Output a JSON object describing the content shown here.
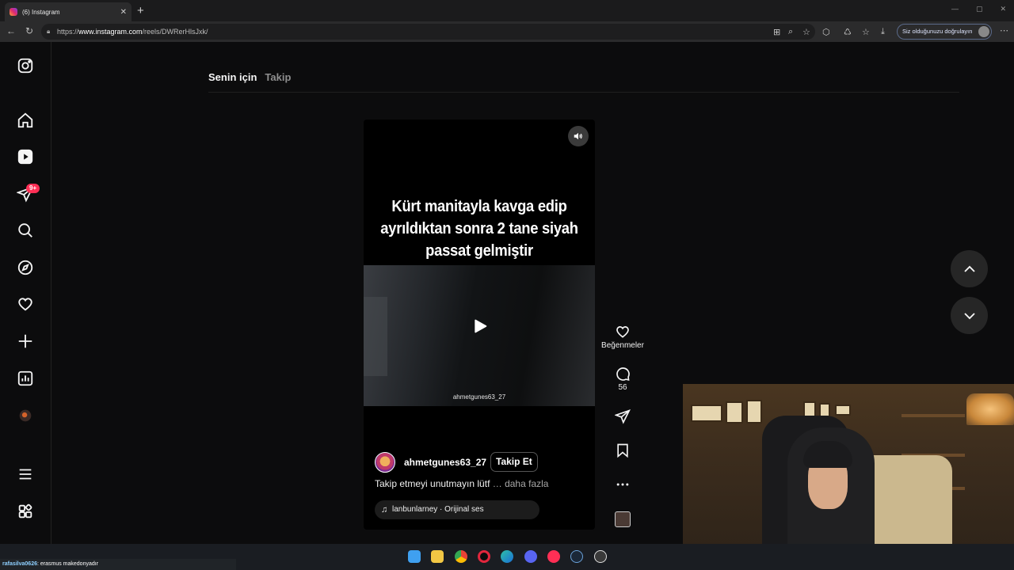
{
  "browser": {
    "tab_title": "(6) Instagram",
    "tab_close": "✕",
    "new_tab": "+",
    "url_prefix": "https://",
    "url_host": "www.instagram.com",
    "url_path": "/reels/DWRerHlsJxk/",
    "profile_text": "Siz olduğunuzu doğrulayın",
    "window_controls": [
      "—",
      "▢",
      "✕"
    ]
  },
  "sidebar": {
    "items": [
      {
        "icon": "instagram-icon"
      },
      {
        "icon": "home-icon"
      },
      {
        "icon": "reels-icon"
      },
      {
        "icon": "messages-icon",
        "badge": "9+"
      },
      {
        "icon": "search-icon"
      },
      {
        "icon": "explore-icon"
      },
      {
        "icon": "notifications-icon"
      },
      {
        "icon": "create-icon"
      },
      {
        "icon": "dashboard-icon"
      },
      {
        "icon": "profile-avatar"
      },
      {
        "icon": "more-menu-icon"
      },
      {
        "icon": "also-from-meta-icon"
      }
    ]
  },
  "feed_tabs": {
    "for_you": "Senin için",
    "following": "Takip"
  },
  "reel": {
    "overlay_text_line1": "Kürt manitayla kavga edip",
    "overlay_text_line2": "ayrıldıktan sonra 2 tane siyah",
    "overlay_text_line3": "passat gelmiştir",
    "watermark": "ahmetgunes63_27",
    "author": "ahmetgunes63_27",
    "follow_label": "Takip Et",
    "caption": "Takip etmeyi unutmayın lütf",
    "caption_more": "… daha fazla",
    "audio": "lanbunlarney · Orijinal ses"
  },
  "actions": {
    "likes_label": "Beğenmeler",
    "comments_count": "56"
  },
  "chat": {
    "user": "rafasilva0626",
    "message": ": erasmus makedonyadır"
  },
  "colors": {
    "badge": "#ff2f55",
    "background": "#0c0c0d"
  }
}
